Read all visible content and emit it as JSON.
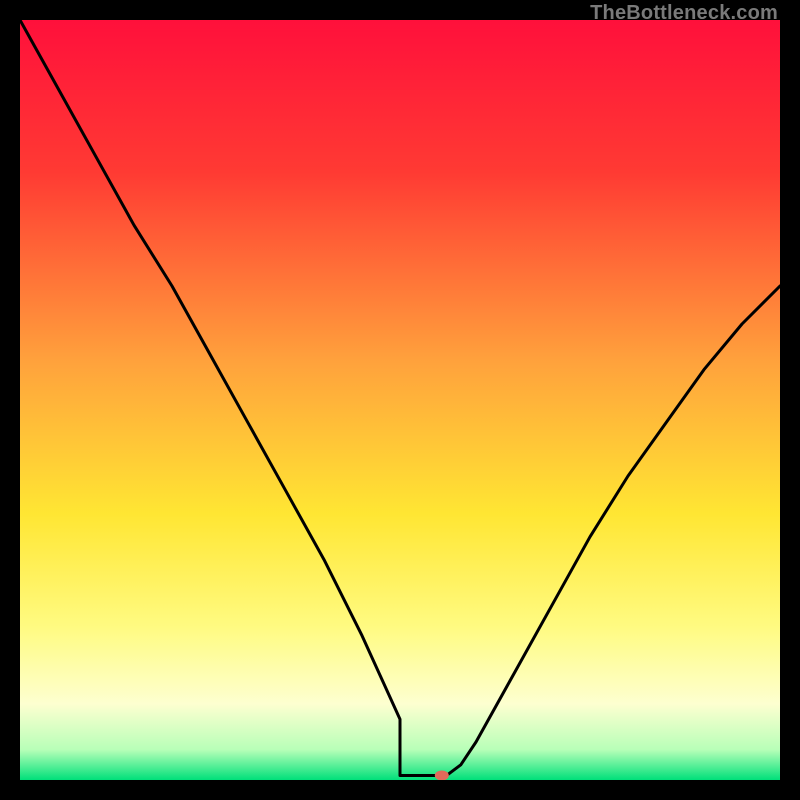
{
  "watermark": "TheBottleneck.com",
  "chart_data": {
    "type": "line",
    "title": "",
    "xlabel": "",
    "ylabel": "",
    "xlim": [
      0,
      100
    ],
    "ylim": [
      0,
      100
    ],
    "gradient_stops": [
      {
        "offset": 0,
        "color": "#ff103b"
      },
      {
        "offset": 20,
        "color": "#ff3a33"
      },
      {
        "offset": 45,
        "color": "#ffa23c"
      },
      {
        "offset": 65,
        "color": "#ffe633"
      },
      {
        "offset": 80,
        "color": "#fffb82"
      },
      {
        "offset": 90,
        "color": "#fdffd0"
      },
      {
        "offset": 96,
        "color": "#b8ffb8"
      },
      {
        "offset": 100,
        "color": "#00e07a"
      }
    ],
    "series": [
      {
        "name": "bottleneck-curve",
        "x": [
          0,
          5,
          10,
          15,
          20,
          25,
          30,
          35,
          40,
          45,
          50,
          52,
          54,
          55,
          56,
          58,
          60,
          65,
          70,
          75,
          80,
          85,
          90,
          95,
          100
        ],
        "y": [
          100,
          91,
          82,
          73,
          65,
          56,
          47,
          38,
          29,
          19,
          8,
          3.7,
          0.9,
          0.4,
          0.5,
          2,
          5,
          14,
          23,
          32,
          40,
          47,
          54,
          60,
          65
        ]
      }
    ],
    "flat_segment": {
      "x0": 50,
      "x1": 56,
      "y": 0.6
    },
    "marker": {
      "x": 55.5,
      "y": 0.6,
      "color": "#e06a5a",
      "rx": 7,
      "ry": 5
    }
  }
}
